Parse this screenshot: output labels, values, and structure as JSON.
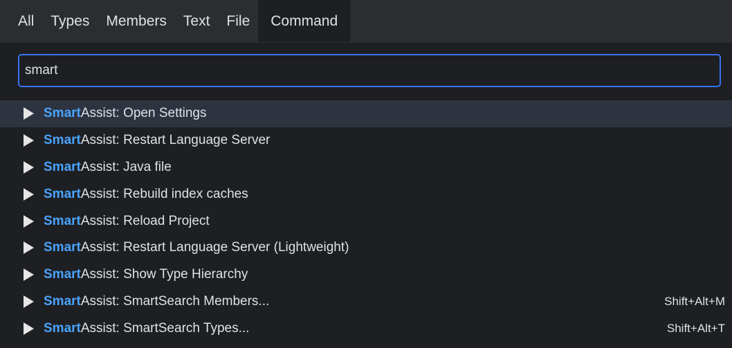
{
  "tabs": [
    {
      "label": "All"
    },
    {
      "label": "Types"
    },
    {
      "label": "Members"
    },
    {
      "label": "Text"
    },
    {
      "label": "File"
    },
    {
      "label": "Command"
    }
  ],
  "active_tab": "Command",
  "search": {
    "value": "smart",
    "placeholder": ""
  },
  "results": [
    {
      "match": "Smart",
      "rest": "Assist: Open Settings",
      "shortcut": ""
    },
    {
      "match": "Smart",
      "rest": "Assist: Restart Language Server",
      "shortcut": ""
    },
    {
      "match": "Smart",
      "rest": "Assist: Java file",
      "shortcut": ""
    },
    {
      "match": "Smart",
      "rest": "Assist: Rebuild index caches",
      "shortcut": ""
    },
    {
      "match": "Smart",
      "rest": "Assist: Reload Project",
      "shortcut": ""
    },
    {
      "match": "Smart",
      "rest": "Assist: Restart Language Server (Lightweight)",
      "shortcut": ""
    },
    {
      "match": "Smart",
      "rest": "Assist: Show Type Hierarchy",
      "shortcut": ""
    },
    {
      "match": "Smart",
      "rest": "Assist: SmartSearch Members...",
      "shortcut": "Shift+Alt+M"
    },
    {
      "match": "Smart",
      "rest": "Assist: SmartSearch Types...",
      "shortcut": "Shift+Alt+T"
    }
  ],
  "selected_index": 0,
  "colors": {
    "background": "#1e1f22",
    "tabbar": "#2b2d30",
    "accent": "#3574f0",
    "match_highlight": "#4aa3ff",
    "selected_row": "#2e3340"
  },
  "icons": {
    "result_icon": "play-icon"
  }
}
